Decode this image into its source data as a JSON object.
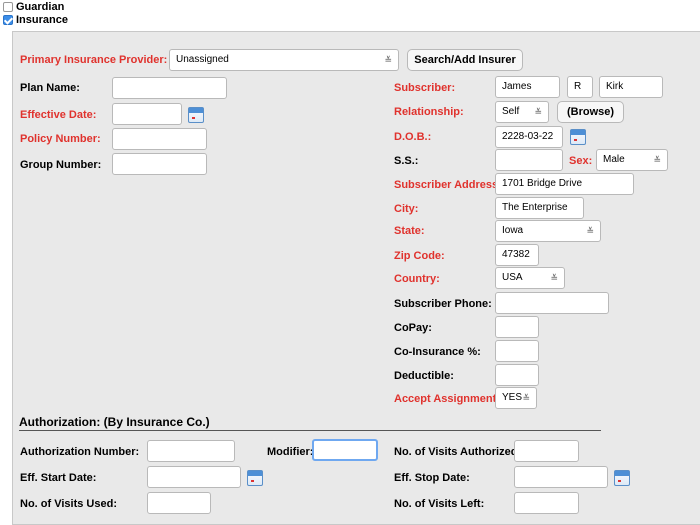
{
  "top_checks": {
    "guardian": {
      "label": "Guardian",
      "checked": false
    },
    "insurance": {
      "label": "Insurance",
      "checked": true
    }
  },
  "provider": {
    "label": "Primary Insurance Provider:",
    "value": "Unassigned",
    "search_button": "Search/Add Insurer"
  },
  "left": {
    "plan_name": {
      "label": "Plan Name:",
      "value": ""
    },
    "effective_date": {
      "label": "Effective Date:",
      "value": ""
    },
    "policy_number": {
      "label": "Policy Number:",
      "value": ""
    },
    "group_number": {
      "label": "Group Number:",
      "value": ""
    }
  },
  "subscriber": {
    "label": "Subscriber:",
    "first": "James",
    "middle": "R",
    "last": "Kirk",
    "relationship_label": "Relationship:",
    "relationship": "Self",
    "browse_button": "(Browse)",
    "dob_label": "D.O.B.:",
    "dob": "2228-03-22",
    "ss_label": "S.S.:",
    "ss": "",
    "sex_label": "Sex:",
    "sex": "Male",
    "address_label": "Subscriber Address:",
    "address": "1701 Bridge Drive",
    "city_label": "City:",
    "city": "The Enterprise",
    "state_label": "State:",
    "state": "Iowa",
    "zip_label": "Zip Code:",
    "zip": "47382",
    "country_label": "Country:",
    "country": "USA",
    "phone_label": "Subscriber Phone:",
    "phone": "",
    "copay_label": "CoPay:",
    "copay": "",
    "coins_label": "Co-Insurance %:",
    "coins": "",
    "deductible_label": "Deductible:",
    "deductible": "",
    "accept_label": "Accept Assignment:",
    "accept": "YES"
  },
  "authorization": {
    "title": "Authorization: (By Insurance Co.)",
    "number_label": "Authorization Number:",
    "number": "",
    "modifier_label": "Modifier:",
    "modifier": "",
    "visits_auth_label": "No. of Visits Authorized:",
    "visits_auth": "",
    "start_label": "Eff. Start Date:",
    "start": "",
    "stop_label": "Eff. Stop Date:",
    "stop": "",
    "used_label": "No. of Visits Used:",
    "used": "",
    "left_label": "No. of Visits Left:",
    "left": ""
  },
  "icons": {
    "calendar": "calendar-icon",
    "select_arrow": "≚"
  }
}
